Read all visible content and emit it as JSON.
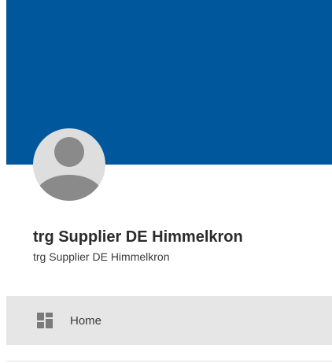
{
  "profile": {
    "name": "trg Supplier DE Himmelkron",
    "subtitle": "trg Supplier DE Himmelkron"
  },
  "navigation": {
    "items": [
      {
        "label": "Home",
        "icon": "dashboard-icon"
      }
    ]
  },
  "colors": {
    "banner": "#00579b",
    "avatar_background": "#dedede",
    "avatar_figure": "#8a8a8a",
    "nav_active_background": "#e6e6e6"
  }
}
